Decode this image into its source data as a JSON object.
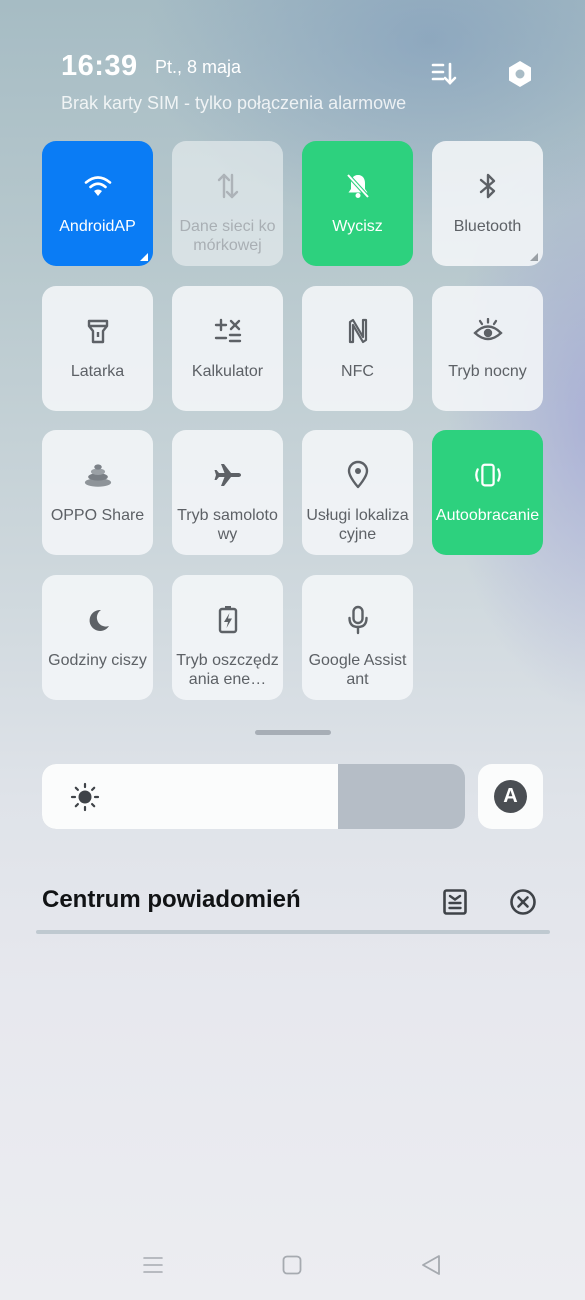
{
  "status": {
    "time": "16:39",
    "date": "Pt., 8 maja",
    "sim_status": "Brak karty SIM - tylko połączenia alarmowe",
    "edit_icon": "edit-order-icon",
    "settings_icon": "settings-hexagon-icon"
  },
  "tiles": [
    {
      "label": "AndroidAP",
      "icon": "wifi-icon",
      "state": "active",
      "color": "#0a7cf5"
    },
    {
      "label": "Dane sieci komórkowej",
      "icon": "mobile-data-icon",
      "state": "unavailable"
    },
    {
      "label": "Wycisz",
      "icon": "bell-off-icon",
      "state": "active",
      "color": "#2dd17e"
    },
    {
      "label": "Bluetooth",
      "icon": "bluetooth-icon",
      "state": "off"
    },
    {
      "label": "Latarka",
      "icon": "flashlight-icon",
      "state": "off"
    },
    {
      "label": "Kalkulator",
      "icon": "calculator-icon",
      "state": "off"
    },
    {
      "label": "NFC",
      "icon": "nfc-icon",
      "state": "off"
    },
    {
      "label": "Tryb nocny",
      "icon": "eye-icon",
      "state": "off"
    },
    {
      "label": "OPPO Share",
      "icon": "oppo-share-icon",
      "state": "off"
    },
    {
      "label": "Tryb samolotowy",
      "icon": "airplane-icon",
      "state": "off"
    },
    {
      "label": "Usługi lokalizacyjne",
      "icon": "location-pin-icon",
      "state": "off"
    },
    {
      "label": "Autoobracanie",
      "icon": "auto-rotate-icon",
      "state": "active",
      "color": "#2dd17e"
    },
    {
      "label": "Godziny ciszy",
      "icon": "moon-icon",
      "state": "off"
    },
    {
      "label": "Tryb oszczędzania ene…",
      "icon": "battery-saver-icon",
      "state": "off"
    },
    {
      "label": "Google Assistant",
      "icon": "microphone-icon",
      "state": "off"
    }
  ],
  "brightness": {
    "level": 0.7,
    "icon": "sun-icon",
    "auto_label": "A"
  },
  "notification_center": {
    "title": "Centrum powiadomień",
    "manage_icon": "notification-manage-icon",
    "clear_icon": "clear-all-icon"
  },
  "nav": {
    "menu_icon": "recent-apps-icon",
    "home_icon": "home-icon",
    "back_icon": "back-icon"
  }
}
